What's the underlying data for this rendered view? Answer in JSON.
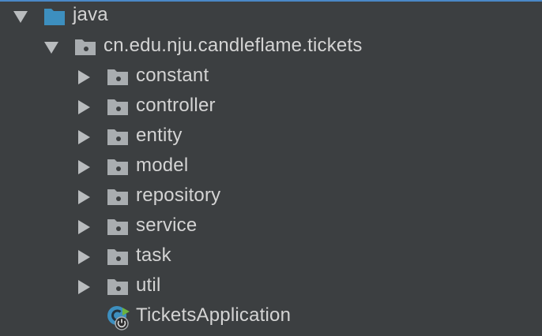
{
  "tree": {
    "root": {
      "label": "java",
      "icon": "source-root-folder-icon",
      "expanded": true
    },
    "package": {
      "label": "cn.edu.nju.candleflame.tickets",
      "icon": "package-icon",
      "expanded": true
    },
    "children": [
      {
        "label": "constant",
        "icon": "package-icon",
        "expanded": false
      },
      {
        "label": "controller",
        "icon": "package-icon",
        "expanded": false
      },
      {
        "label": "entity",
        "icon": "package-icon",
        "expanded": false
      },
      {
        "label": "model",
        "icon": "package-icon",
        "expanded": false
      },
      {
        "label": "repository",
        "icon": "package-icon",
        "expanded": false
      },
      {
        "label": "service",
        "icon": "package-icon",
        "expanded": false
      },
      {
        "label": "task",
        "icon": "package-icon",
        "expanded": false
      },
      {
        "label": "util",
        "icon": "package-icon",
        "expanded": false
      }
    ],
    "app_class": {
      "label": "TicketsApplication",
      "icon": "spring-boot-class-icon"
    }
  },
  "colors": {
    "background": "#3c3f41",
    "text": "#d4d4d4",
    "arrow": "#b9bcbe",
    "source_root_folder": "#3d8fbf",
    "package_folder": "#a9adb0",
    "top_border": "#4a88c7",
    "class_icon": "#3d8fbf",
    "spring_badge": "#6db33f"
  }
}
